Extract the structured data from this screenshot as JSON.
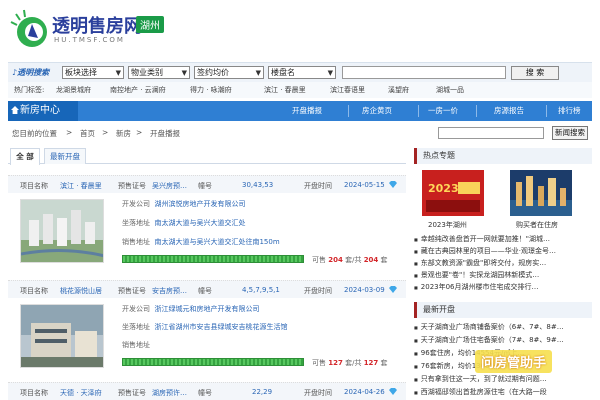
{
  "header": {
    "site_name": "透明售房网",
    "city": "湖州",
    "domain": "HU.TMSF.COM"
  },
  "search": {
    "label": "透明搜索",
    "selects": [
      "板块选择",
      "物业类别",
      "签约均价",
      "楼盘名"
    ],
    "button": "搜 索"
  },
  "hot_tags": {
    "title": "热门标签:",
    "items": [
      "龙湖景城府",
      "南控地产 · 云澜府",
      "得力 · 咏潮府",
      "滨江 · 春晨里",
      "滨江春语里",
      "溪望府",
      "湖城一品"
    ]
  },
  "nav": {
    "brand": "新房中心",
    "items": [
      "开盘播报",
      "房企黄页",
      "一房一价",
      "房源报告",
      "排行榜"
    ]
  },
  "breadcrumb": {
    "prefix": "您目前的位置",
    "home": "首页",
    "section": "新房",
    "current": "开盘播报",
    "button": "新闻搜索"
  },
  "tabs": [
    "全 部",
    "最新开盘"
  ],
  "labels": {
    "project": "项目名称",
    "permit": "预售证号",
    "building": "幢号",
    "open_time": "开盘时间",
    "developer": "开发公司",
    "location": "坐落地址",
    "sales": "销售地址",
    "avail_prefix": "可售",
    "avail_mid": "套/共",
    "avail_suffix": "套"
  },
  "listings": [
    {
      "name": "滨江 · 春晨里",
      "permit": "吴兴房预…",
      "buildings": "30,43,53",
      "date": "2024-05-15",
      "developer": "湖州滨悦房地产开发有限公司",
      "location": "南太湖大道与吴兴大道交汇处",
      "sales": "南太湖大道与吴兴大道交汇处往南150m",
      "available": 204,
      "total": 204,
      "sold_fraction": 1.0
    },
    {
      "name": "桃花源悦山居",
      "permit": "安吉房预…",
      "buildings": "4,5,7,9,5,1",
      "date": "2024-03-09",
      "developer": "浙江绿城元和房地产开发有限公司",
      "location": "浙江省湖州市安吉县绿城安吉桃花源生活馆",
      "sales": "",
      "available": 127,
      "total": 127,
      "sold_fraction": 1.0
    },
    {
      "name": "天德 · 天泽府",
      "permit": "湖房预许…",
      "buildings": "22,29",
      "date": "2024-04-26"
    }
  ],
  "sidebar": {
    "hot_title": "热点专题",
    "hot_images": [
      {
        "caption": "2023年湖州",
        "banner": "2023"
      },
      {
        "caption": "购买者在住房"
      }
    ],
    "hot_news": [
      "幸越纯改善盘首开一网就要加推！\"湖城…",
      "藏在古典园林里的项目——华业·观璟金号…",
      "东部文教资源\"霸盘\"即将交付，规房实…",
      "景观也要\"卷\"！实探龙湖园林新模式…",
      "2023年06月湖州楼市住宅成交排行…"
    ],
    "new_title": "最新开盘",
    "new_items": [
      "天子湖商业广场商铺备案价（6#、7#、8#…",
      "天子湖商业广场住宅备案价（7#、8#、9#…",
      "96套住房，均价14554元/㎡上…",
      "76套新房，均价13005元/㎡上…",
      "只有拿到住这一天，到了就过期有问题…",
      "西湖福邸领出首批房源住宅（在大路一段"
    ]
  },
  "watermark": "问房管助手"
}
